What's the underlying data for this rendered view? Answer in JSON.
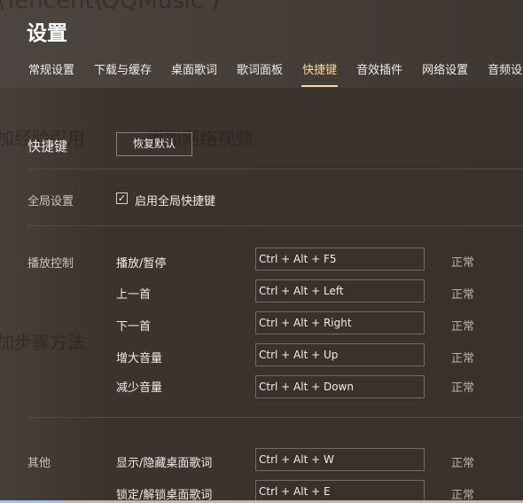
{
  "background_text": {
    "path": "\\Tencent\\QQMusic )",
    "g1": "加经验引用",
    "g2": "添加网络视频",
    "g3": "加步骤方法"
  },
  "title": "设置",
  "tabs": [
    {
      "label": "常规设置"
    },
    {
      "label": "下载与缓存"
    },
    {
      "label": "桌面歌词"
    },
    {
      "label": "歌词面板"
    },
    {
      "label": "快捷键",
      "active": true
    },
    {
      "label": "音效插件"
    },
    {
      "label": "网络设置"
    },
    {
      "label": "音频设置"
    }
  ],
  "section": {
    "title": "快捷键",
    "restore_label": "恢复默认"
  },
  "global": {
    "label": "全局设置",
    "checkbox_label": "启用全局快捷键",
    "checked": true
  },
  "playback": {
    "label": "播放控制",
    "items": [
      {
        "name": "播放/暂停",
        "key": "Ctrl + Alt + F5",
        "status": "正常"
      },
      {
        "name": "上一首",
        "key": "Ctrl + Alt + Left",
        "status": "正常"
      },
      {
        "name": "下一首",
        "key": "Ctrl + Alt + Right",
        "status": "正常"
      },
      {
        "name": "增大音量",
        "key": "Ctrl + Alt + Up",
        "status": "正常"
      },
      {
        "name": "减少音量",
        "key": "Ctrl + Alt + Down",
        "status": "正常"
      }
    ]
  },
  "other": {
    "label": "其他",
    "items": [
      {
        "name": "显示/隐藏桌面歌词",
        "key": "Ctrl + Alt + W",
        "status": "正常"
      },
      {
        "name": "锁定/解锁桌面歌词",
        "key": "Ctrl + Alt + E",
        "status": "正常"
      }
    ]
  },
  "colors": {
    "accent": "#f2dba6",
    "background": "#3b322d"
  }
}
